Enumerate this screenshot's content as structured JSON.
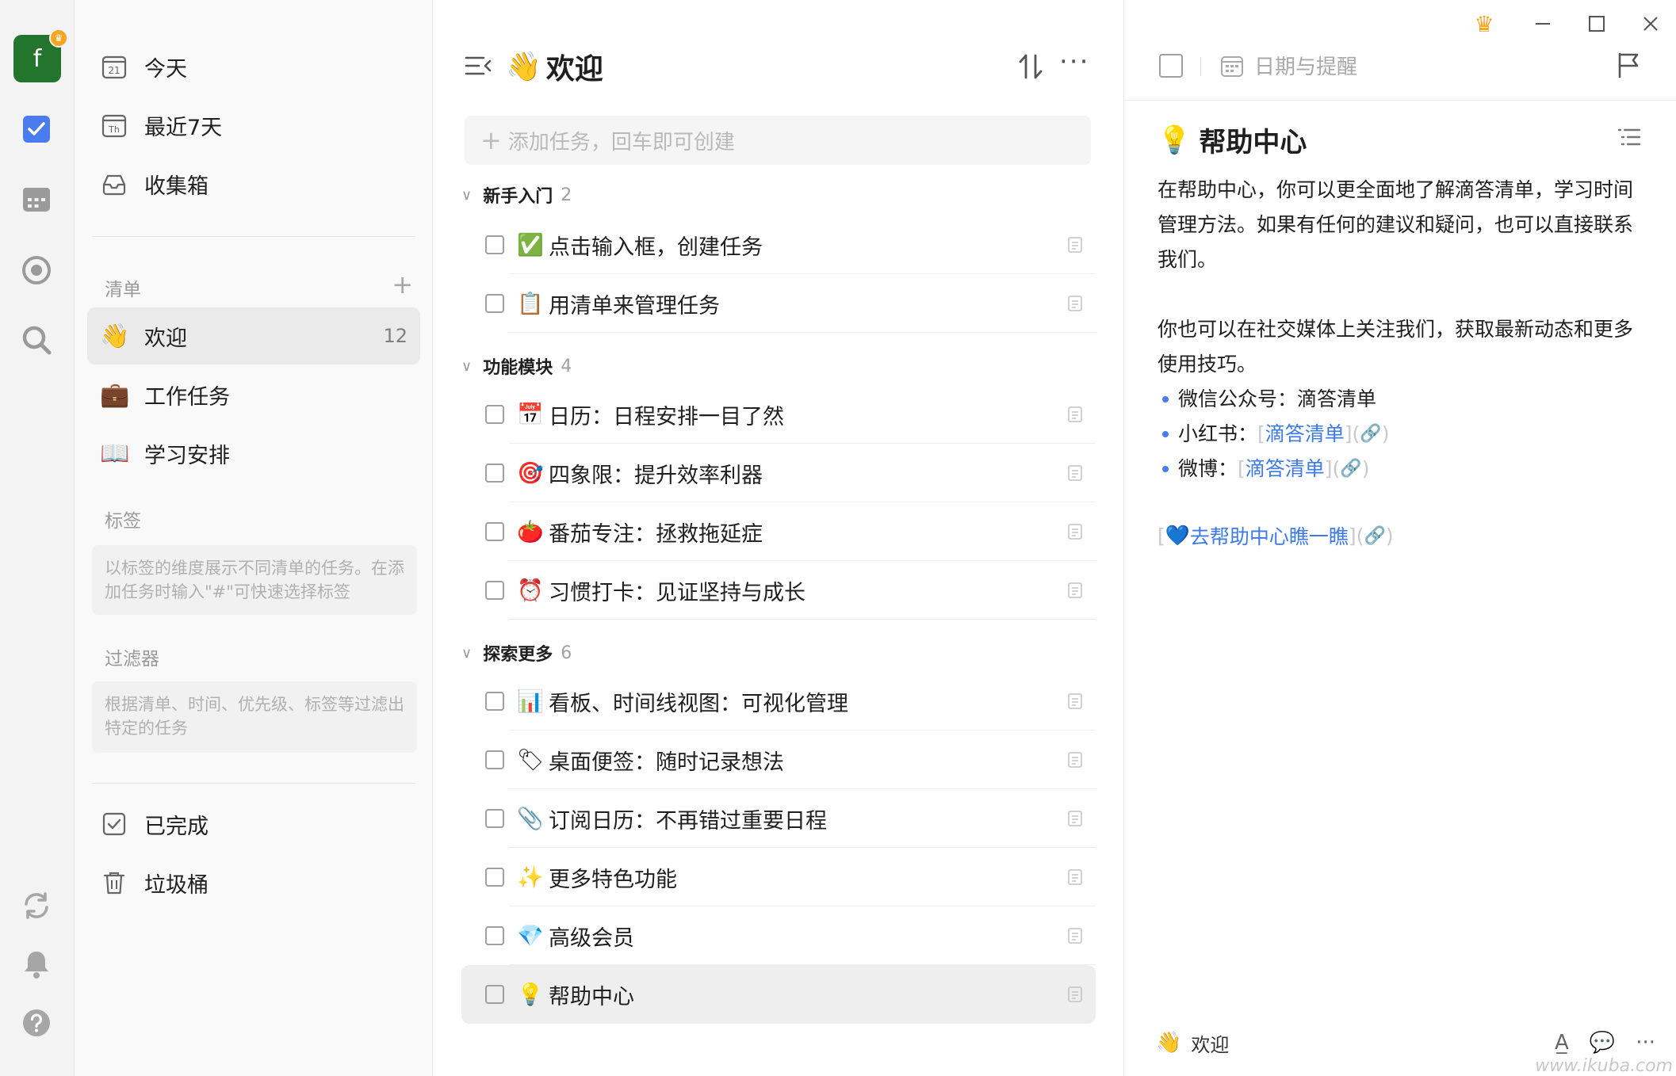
{
  "rail": {
    "avatar_letter": "f",
    "avatar_color": "#23742c",
    "items": [
      {
        "icon": "checkbox-icon",
        "active": true
      },
      {
        "icon": "calendar-icon"
      },
      {
        "icon": "focus-icon"
      },
      {
        "icon": "search-icon"
      }
    ],
    "bottom": [
      {
        "icon": "sync-icon"
      },
      {
        "icon": "bell-icon"
      },
      {
        "icon": "help-icon"
      }
    ]
  },
  "sidebar": {
    "smart_lists": [
      {
        "label": "今天",
        "icon": "calendar-day-icon",
        "day": "21"
      },
      {
        "label": "最近7天",
        "icon": "calendar-week-icon",
        "day": "Th"
      },
      {
        "label": "收集箱",
        "icon": "inbox-icon"
      }
    ],
    "lists_title": "清单",
    "lists": [
      {
        "label": "欢迎",
        "emoji": "👋",
        "count": "12",
        "active": true
      },
      {
        "label": "工作任务",
        "emoji": "💼"
      },
      {
        "label": "学习安排",
        "emoji": "📖"
      }
    ],
    "tags_title": "标签",
    "tags_hint": "以标签的维度展示不同清单的任务。在添加任务时输入\"#\"可快速选择标签",
    "filters_title": "过滤器",
    "filters_hint": "根据清单、时间、优先级、标签等过滤出特定的任务",
    "bottom_items": [
      {
        "label": "已完成",
        "icon": "completed-icon"
      },
      {
        "label": "垃圾桶",
        "icon": "trash-icon"
      }
    ]
  },
  "tasklist": {
    "title": "欢迎",
    "title_emoji": "👋",
    "add_placeholder": "添加任务，回车即可创建",
    "groups": [
      {
        "name": "新手入门",
        "count": "2",
        "tasks": [
          {
            "emoji": "✅",
            "title": "点击输入框，创建任务"
          },
          {
            "emoji": "📋",
            "title": "用清单来管理任务"
          }
        ]
      },
      {
        "name": "功能模块",
        "count": "4",
        "tasks": [
          {
            "emoji": "📅",
            "title": "日历：日程安排一目了然"
          },
          {
            "emoji": "🎯",
            "title": "四象限：提升效率利器"
          },
          {
            "emoji": "🍅",
            "title": "番茄专注：拯救拖延症"
          },
          {
            "emoji": "⏰",
            "title": "习惯打卡：见证坚持与成长"
          }
        ]
      },
      {
        "name": "探索更多",
        "count": "6",
        "tasks": [
          {
            "emoji": "📊",
            "title": "看板、时间线视图：可视化管理"
          },
          {
            "emoji": "🏷",
            "title": "桌面便签：随时记录想法"
          },
          {
            "emoji": "📎",
            "title": "订阅日历：不再错过重要日程"
          },
          {
            "emoji": "✨",
            "title": "更多特色功能"
          },
          {
            "emoji": "💎",
            "title": "高级会员"
          },
          {
            "emoji": "💡",
            "title": "帮助中心",
            "selected": true
          }
        ]
      }
    ]
  },
  "detail": {
    "date_label": "日期与提醒",
    "title": "帮助中心",
    "title_emoji": "💡",
    "para1": "在帮助中心，你可以更全面地了解滴答清单，学习时间管理方法。如果有任何的建议和疑问，也可以直接联系我们。",
    "para2": "你也可以在社交媒体上关注我们，获取最新动态和更多使用技巧。",
    "bullets": [
      {
        "prefix": "微信公众号：",
        "text": "滴答清单",
        "link": false
      },
      {
        "prefix": "小红书：",
        "text": "滴答清单",
        "link": true
      },
      {
        "prefix": "微博：",
        "text": "滴答清单",
        "link": true
      }
    ],
    "help_link": "去帮助中心瞧一瞧",
    "footer_list": "欢迎",
    "footer_emoji": "👋"
  },
  "watermark": "www.ikuba.com",
  "colors": {
    "accent": "#4a7cf0",
    "link": "#3d7ae8",
    "crown": "#f6a523"
  }
}
